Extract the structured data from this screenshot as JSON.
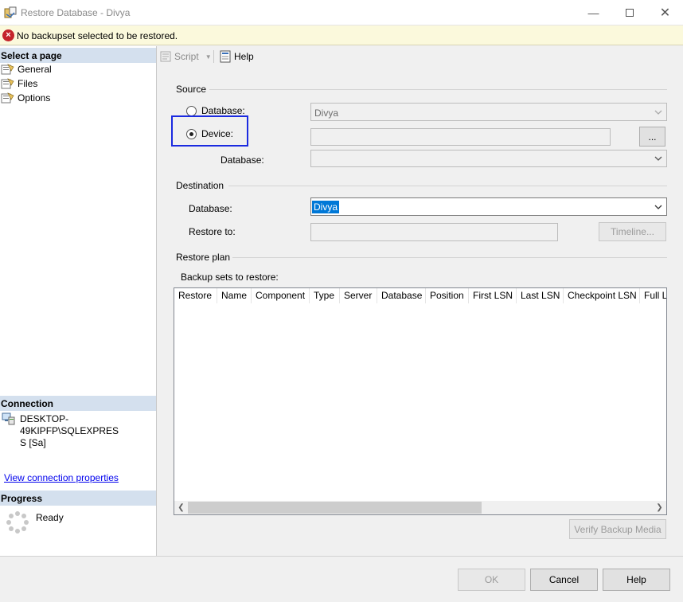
{
  "window": {
    "title": "Restore Database - Divya",
    "minimize_icon": "minimize-icon",
    "maximize_icon": "maximize-icon",
    "close_icon": "close-icon"
  },
  "error_bar": {
    "icon": "error-icon",
    "message": "No backupset selected to be restored."
  },
  "left_panel": {
    "select_page_header": "Select a page",
    "pages": [
      {
        "label": "General",
        "icon": "page-icon"
      },
      {
        "label": "Files",
        "icon": "page-icon"
      },
      {
        "label": "Options",
        "icon": "page-icon"
      }
    ],
    "connection_header": "Connection",
    "connection_server": "DESKTOP-49KIPFP\\SQLEXPRESS [Sa]",
    "connection_server_line1": "DESKTOP-49KIPFP\\SQLEXPRES",
    "connection_server_line2": "S [Sa]",
    "view_connection_properties": "View connection properties",
    "progress_header": "Progress",
    "progress_status": "Ready"
  },
  "toolbar": {
    "script_label": "Script",
    "help_label": "Help"
  },
  "source": {
    "section_label": "Source",
    "database_radio_label": "Database:",
    "database_radio_selected": false,
    "database_value": "Divya",
    "device_radio_label": "Device:",
    "device_radio_selected": true,
    "device_value": "",
    "browse_label": "...",
    "device_database_label": "Database:",
    "device_database_value": ""
  },
  "destination": {
    "section_label": "Destination",
    "database_label": "Database:",
    "database_value": "Divya",
    "restore_to_label": "Restore to:",
    "restore_to_value": "",
    "timeline_label": "Timeline..."
  },
  "restore_plan": {
    "section_label": "Restore plan",
    "backup_sets_label": "Backup sets to restore:",
    "columns": [
      "Restore",
      "Name",
      "Component",
      "Type",
      "Server",
      "Database",
      "Position",
      "First LSN",
      "Last LSN",
      "Checkpoint LSN",
      "Full LS"
    ],
    "rows": [],
    "verify_label": "Verify Backup Media"
  },
  "footer": {
    "ok_label": "OK",
    "cancel_label": "Cancel",
    "help_label": "Help"
  },
  "colors": {
    "error_bar_bg": "#fbf9dc",
    "error_icon": "#c4242b",
    "section_header_bg": "#d4e0ee",
    "highlight_box": "#1b2be0",
    "selection": "#0078d7"
  }
}
